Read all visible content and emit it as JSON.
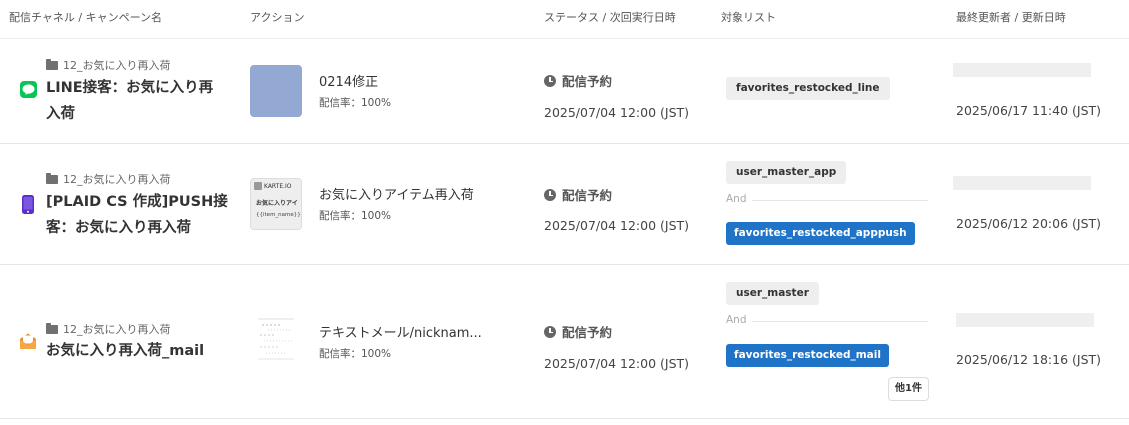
{
  "header": {
    "channel_campaign": "配信チャネル / キャンペーン名",
    "action": "アクション",
    "status_next": "ステータス / 次回実行日時",
    "target_list": "対象リスト",
    "updated": "最終更新者 / 更新日時"
  },
  "rows": [
    {
      "folder": "12_お気に入り再入荷",
      "channel_icon": "line-icon",
      "name_line1": "LINE接客：お気に入り再",
      "name_line2": "入荷",
      "action_name": "0214修正",
      "action_rate": "配信率：100%",
      "status": "配信予約",
      "next_date": "2025/07/04 12:00 (JST)",
      "tags": [
        "favorites_restocked_line"
      ],
      "updated_date": "2025/06/17 11:40 (JST)"
    },
    {
      "folder": "12_お気に入り再入荷",
      "channel_icon": "app-push-icon",
      "name_line1": "[PLAID CS 作成]PUSH接",
      "name_line2": "客：お気に入り再入荷",
      "thumb_title": "KARTE.IO",
      "thumb_line1": "お気に入りアイ",
      "thumb_line2": "{{item_name}}",
      "action_name": "お気に入りアイテム再入荷",
      "action_rate": "配信率：100%",
      "status": "配信予約",
      "next_date": "2025/07/04 12:00 (JST)",
      "tags": [
        "user_master_app",
        "favorites_restocked_apppush"
      ],
      "and": "And",
      "updated_date": "2025/06/12 20:06 (JST)"
    },
    {
      "folder": "12_お気に入り再入荷",
      "channel_icon": "mail-icon",
      "name_line1": "お気に入り再入荷_mail",
      "action_name": "テキストメール/nicknam...",
      "action_rate": "配信率：100%",
      "status": "配信予約",
      "next_date": "2025/07/04 12:00 (JST)",
      "tags": [
        "user_master",
        "favorites_restocked_mail"
      ],
      "and": "And",
      "more": "他1件",
      "updated_date": "2025/06/12 18:16 (JST)"
    }
  ],
  "colors": {
    "line": "#06c755",
    "push": "#5b2fc9",
    "mail": "#f08a1c",
    "thumb_blue": "#93a9d4",
    "tag_blue": "#1f74c7"
  }
}
